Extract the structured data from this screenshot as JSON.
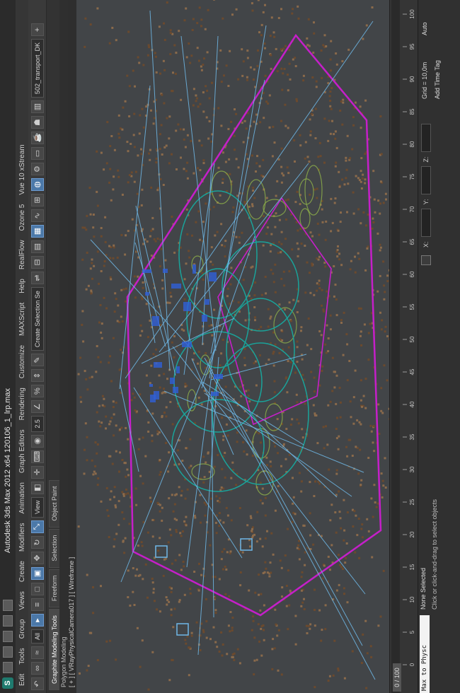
{
  "app": {
    "title": "Autodesk 3ds Max 2012 x64    120106_1_lrp.max",
    "logo_letter": "S"
  },
  "menu": [
    "Edit",
    "Tools",
    "Group",
    "Views",
    "Create",
    "Modifiers",
    "Animation",
    "Graph Editors",
    "Rendering",
    "Customize",
    "MAXScript",
    "Help",
    "RealFlow",
    "Ozone 5",
    "Vue 10 xStream"
  ],
  "toolbar": {
    "filter_value": "All",
    "view_value": "View",
    "spinner_value": "2.5",
    "selection_set_placeholder": "Create Selection Se",
    "layer_value": "502_transport_DK"
  },
  "ribbon": {
    "tabs": [
      "Graphite Modeling Tools",
      "Freeform",
      "Selection",
      "Object Paint"
    ],
    "active_tab": "Graphite Modeling Tools",
    "sub_label": "Polygon Modeling"
  },
  "viewport": {
    "label": "[ + ] [ VRayPhysicalCamera017 ] [ Wireframe ]",
    "background_color": "#424548",
    "accent_colors": {
      "magenta": "#c51fc9",
      "teal": "#1aa39a",
      "light_blue": "#6fb8e8",
      "blue": "#2f5fd8",
      "brown_dots": "#6b4a2e",
      "green": "#8fb04a"
    }
  },
  "timeline": {
    "frame_display": "0 / 100",
    "ticks": [
      "0",
      "5",
      "10",
      "15",
      "20",
      "25",
      "30",
      "35",
      "40",
      "45",
      "50",
      "55",
      "60",
      "65",
      "70",
      "75",
      "80",
      "85",
      "90",
      "95",
      "100"
    ]
  },
  "status": {
    "maxscript_text": "Max to Physc",
    "selection_text": "None Selected",
    "prompt_text": "Click or click-and-drag to select objects",
    "coord_labels": [
      "X:",
      "Y:",
      "Z:"
    ],
    "grid_text": "Grid = 10,0m",
    "add_time_tag": "Add Time Tag",
    "auto_key": "Auto"
  }
}
